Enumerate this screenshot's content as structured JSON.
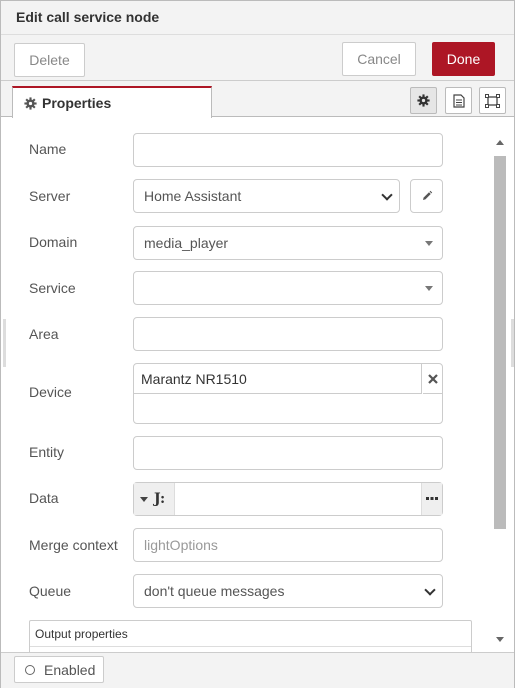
{
  "header": {
    "title": "Edit call service node"
  },
  "toolbar": {
    "delete_label": "Delete",
    "cancel_label": "Cancel",
    "done_label": "Done"
  },
  "tabs": {
    "properties_label": "Properties"
  },
  "form": {
    "name_label": "Name",
    "name_value": "",
    "server_label": "Server",
    "server_value": "Home Assistant",
    "domain_label": "Domain",
    "domain_value": "media_player",
    "service_label": "Service",
    "service_value": "",
    "area_label": "Area",
    "area_value": "",
    "device_label": "Device",
    "device_tag": "Marantz NR1510",
    "entity_label": "Entity",
    "entity_value": "",
    "data_label": "Data",
    "data_type_symbol": "J:",
    "data_value": "",
    "merge_context_label": "Merge context",
    "merge_context_placeholder": "lightOptions",
    "queue_label": "Queue",
    "queue_value": "don't queue messages",
    "output_properties_label": "Output properties"
  },
  "footer": {
    "enabled_label": "Enabled"
  },
  "colors": {
    "accent": "#ad1625"
  }
}
